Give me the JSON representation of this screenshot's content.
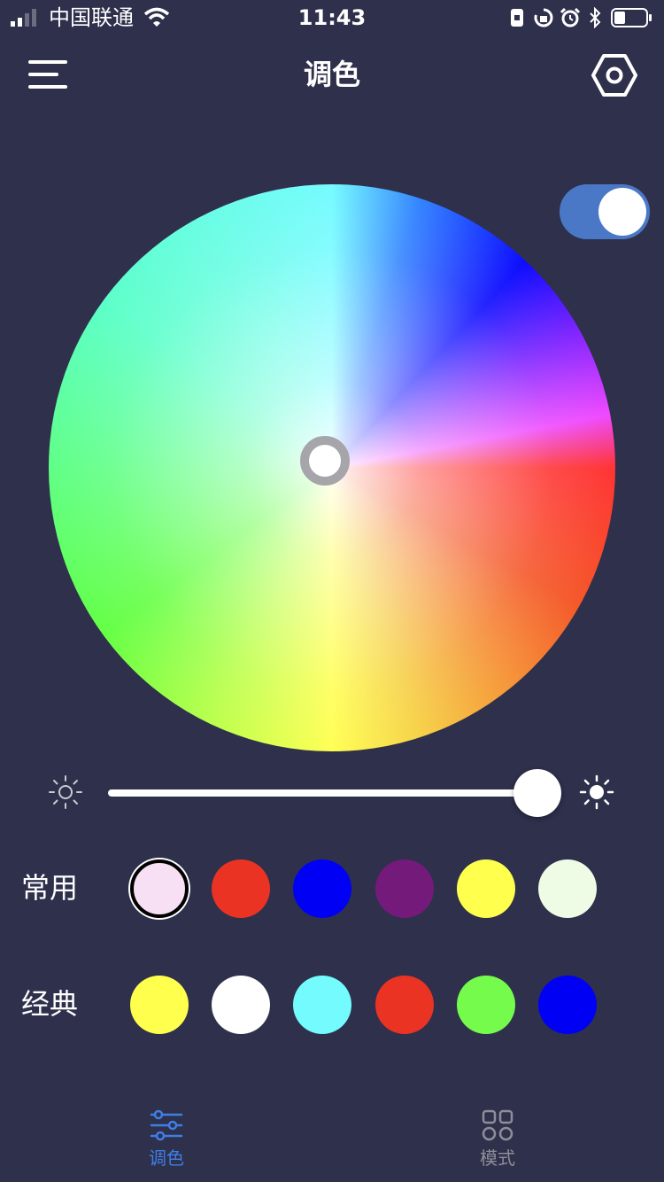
{
  "status_bar": {
    "carrier": "中国联通",
    "time": "11:43",
    "icons": [
      "signal-icon",
      "wifi-icon",
      "portrait-lock-icon",
      "rotation-lock-icon",
      "alarm-icon",
      "bluetooth-icon",
      "battery-icon"
    ]
  },
  "header": {
    "title": "调色",
    "menu_icon": "hamburger-menu-icon",
    "settings_icon": "hexagon-settings-icon"
  },
  "color_wheel": {
    "selected_color": "#fff6ff"
  },
  "power": {
    "on": true,
    "color": "#4a78c6"
  },
  "brightness": {
    "value_percent": 99,
    "dim_icon": "sun-dim-icon",
    "bright_icon": "sun-bright-icon"
  },
  "presets": {
    "common_label": "常用",
    "common_colors": [
      "#f8e0f4",
      "#ea3323",
      "#0000f5",
      "#741a7b",
      "#ffff4d",
      "#eefce6"
    ],
    "common_selected_index": 0,
    "classic_label": "经典",
    "classic_colors": [
      "#ffff4d",
      "#ffffff",
      "#73fbfd",
      "#ea3323",
      "#75fb4c",
      "#0000f5"
    ]
  },
  "tabbar": {
    "tabs": [
      {
        "label": "调色",
        "icon": "sliders-icon",
        "active": true
      },
      {
        "label": "模式",
        "icon": "grid-icon",
        "active": false
      }
    ],
    "active_color": "#3e7fe6",
    "inactive_color": "#8e8e98"
  }
}
